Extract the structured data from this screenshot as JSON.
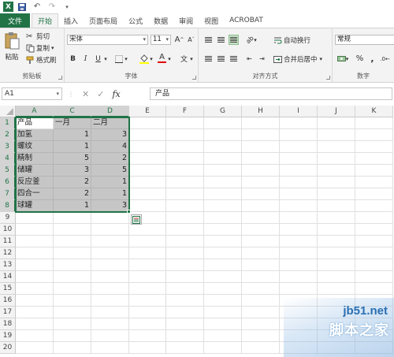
{
  "quick_access": {
    "items": [
      "excel-logo",
      "save-icon",
      "undo-icon",
      "redo-icon",
      "customize-icon"
    ]
  },
  "tabs": [
    {
      "label": "文件",
      "kind": "file"
    },
    {
      "label": "开始",
      "kind": "active"
    },
    {
      "label": "插入"
    },
    {
      "label": "页面布局"
    },
    {
      "label": "公式"
    },
    {
      "label": "数据"
    },
    {
      "label": "审阅"
    },
    {
      "label": "视图"
    },
    {
      "label": "ACROBAT"
    }
  ],
  "ribbon": {
    "clipboard": {
      "paste": "粘贴",
      "cut": "剪切",
      "copy": "复制",
      "format_painter": "格式刷",
      "group": "剪贴板"
    },
    "font": {
      "name": "宋体",
      "size": "11",
      "grow": "A",
      "shrink": "A",
      "bold": "B",
      "italic": "I",
      "underline": "U",
      "font_color_label": "A",
      "phonetic": "文",
      "group": "字体"
    },
    "alignment": {
      "wrap": "自动换行",
      "merge": "合并后居中",
      "group": "对齐方式"
    },
    "number": {
      "format": "常规",
      "percent": "%",
      "comma": ",",
      "group": "数字"
    }
  },
  "formula_bar": {
    "name_box": "A1",
    "cancel": "✕",
    "enter": "✓",
    "fx": "fx",
    "content": "产品"
  },
  "columns": [
    {
      "label": "A",
      "selected": true
    },
    {
      "label": "C",
      "selected": true
    },
    {
      "label": "D",
      "selected": true
    },
    {
      "label": "E"
    },
    {
      "label": "F"
    },
    {
      "label": "G"
    },
    {
      "label": "H"
    },
    {
      "label": "I"
    },
    {
      "label": "J"
    },
    {
      "label": "K"
    }
  ],
  "rows": [
    "1",
    "2",
    "3",
    "4",
    "5",
    "6",
    "7",
    "8",
    "9",
    "10",
    "11",
    "12",
    "13",
    "14",
    "15",
    "16",
    "17",
    "18",
    "19",
    "20"
  ],
  "table": {
    "headers": [
      "产品",
      "一月",
      "二月"
    ],
    "data": [
      [
        "加氢",
        "1",
        "3"
      ],
      [
        "螺纹",
        "1",
        "4"
      ],
      [
        "精制",
        "5",
        "2"
      ],
      [
        "储罐",
        "3",
        "5"
      ],
      [
        "反应釜",
        "2",
        "1"
      ],
      [
        "四合一",
        "2",
        "1"
      ],
      [
        "球罐",
        "1",
        "3"
      ]
    ]
  },
  "watermark": {
    "url": "jb51.net",
    "text": "脚本之家"
  },
  "colors": {
    "excel_green": "#217346",
    "selection_fill": "#c6c6c6"
  }
}
